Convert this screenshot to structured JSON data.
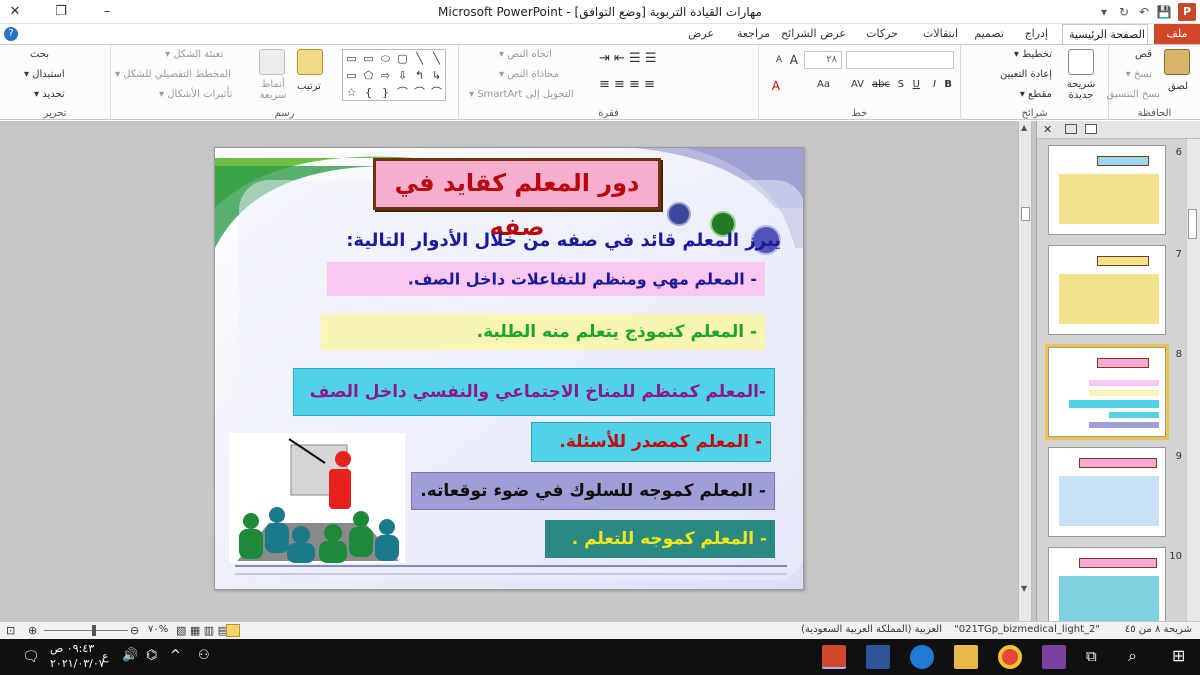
{
  "window": {
    "title": "مهارات القيادة التربوية [وضع التوافق] - Microsoft PowerPoint",
    "minimize": "–",
    "restore": "❐",
    "close": "✕"
  },
  "qat": {
    "save": "💾",
    "undo": "↶",
    "redo": "↻",
    "more": "▾"
  },
  "tabs": [
    {
      "label": "ملف"
    },
    {
      "label": "الصفحة الرئيسية"
    },
    {
      "label": "إدراج"
    },
    {
      "label": "تصميم"
    },
    {
      "label": "انتقالات"
    },
    {
      "label": "حركات"
    },
    {
      "label": "عرض الشرائح"
    },
    {
      "label": "مراجعة"
    },
    {
      "label": "عرض"
    }
  ],
  "ribbon": {
    "clipboard": {
      "label": "الحافظة",
      "paste": "لصق",
      "cut": "قص",
      "copy": "نسخ ▾",
      "format_painter": "نسخ التنسيق"
    },
    "slides": {
      "label": "شرائح",
      "new_slide": "شريحة جديدة",
      "layout": "تخطيط ▾",
      "reset": "إعادة التعيين",
      "section": "مقطع ▾"
    },
    "font": {
      "label": "خط",
      "size": "٢٨",
      "buttons": [
        "A",
        "A",
        "Aa",
        "B",
        "I",
        "U",
        "S",
        "abc",
        "AV",
        "Aa",
        "A"
      ]
    },
    "paragraph": {
      "label": "فقرة",
      "direction": "اتجاه النص ▾",
      "align": "محاذاة النص ▾",
      "smartart": "التحويل إلى SmartArt ▾"
    },
    "drawing": {
      "label": "رسم",
      "arrange": "ترتيب",
      "quick_styles": "أنماط سريعة",
      "fill": "تعبئة الشكل ▾",
      "outline": "المخطط التفصيلي للشكل ▾",
      "effects": "تأثيرات الأشكال ▾",
      "shapes": [
        "▭",
        "▭",
        "⬭",
        "▢",
        "╲",
        "╲",
        "▭",
        "⬠",
        "⇨",
        "⇩",
        "↰",
        "↳",
        "☆",
        "{",
        "}",
        "⌒",
        "⌒",
        "⌒"
      ]
    },
    "editing": {
      "label": "تحرير",
      "find": "بحث",
      "replace": "استبدال ▾",
      "select": "تحديد ▾"
    }
  },
  "slide": {
    "title": "دور المعلم كقايد في صفه",
    "intro": "يبرز المعلم قائد في صفه من خلال الأدوار التالية:",
    "items": [
      {
        "text": "- المعلم مهي ومنظم للتفاعلات داخل الصف.",
        "bg": "#f9c8f0",
        "color": "#1a1a9a"
      },
      {
        "text": "- المعلم كنموذج يتعلم منه الطلبة.",
        "bg": "#fbf5b4",
        "color": "#19a62a"
      },
      {
        "text": "-المعلم كمنظم للمناخ الاجتماعي والنفسي داخل الصف",
        "bg": "#52d2e8",
        "color": "#8a1a8a"
      },
      {
        "text": "- المعلم كمصدر للأسئلة.",
        "bg": "#52d2e8",
        "color": "#c0080c"
      },
      {
        "text": "- المعلم كموجه للسلوك في ضوء توقعاته.",
        "bg": "#a09ed6",
        "color": "#101010"
      },
      {
        "text": "- المعلم كموجه للتعلم .",
        "bg": "#2a8a82",
        "color": "#f5e61a"
      }
    ]
  },
  "thumbnails": [
    {
      "num": "6",
      "selected": false
    },
    {
      "num": "7",
      "selected": false
    },
    {
      "num": "8",
      "selected": true
    },
    {
      "num": "9",
      "selected": false
    },
    {
      "num": "10",
      "selected": false
    }
  ],
  "statusbar": {
    "slide_info": "شريحة ٨ من ٤٥",
    "theme": "\"2_021TGp_bizmedical_light\"",
    "language": "العربية (المملكة العربية السعودية)",
    "zoom": "%٧٠"
  },
  "taskbar": {
    "time": "٠٩:٤٣ ص",
    "date": "٢٠٢١/٠٣/٠٧",
    "lang": "ع"
  }
}
